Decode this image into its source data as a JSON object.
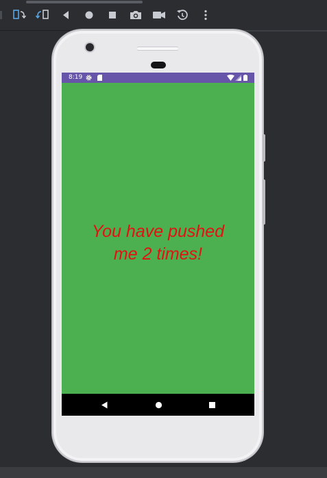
{
  "toolbar": {
    "icons": [
      "rotate-left-icon",
      "rotate-right-icon",
      "back-icon",
      "home-icon",
      "overview-icon",
      "screenshot-icon",
      "screen-record-icon",
      "snapshot-restore-icon",
      "more-options-icon"
    ]
  },
  "status_bar": {
    "time": "8:19",
    "icons": [
      "settings-icon",
      "sd-card-icon",
      "wifi-icon",
      "cell-signal-icon",
      "battery-icon"
    ],
    "color": "#6655a8"
  },
  "app": {
    "message_line1": "You have pushed",
    "message_line2": "me 2 times!",
    "background_color": "#4caf50",
    "text_color": "#e31212"
  },
  "nav_bar": {
    "icons": [
      "nav-back-icon",
      "nav-home-icon",
      "nav-recents-icon"
    ]
  }
}
